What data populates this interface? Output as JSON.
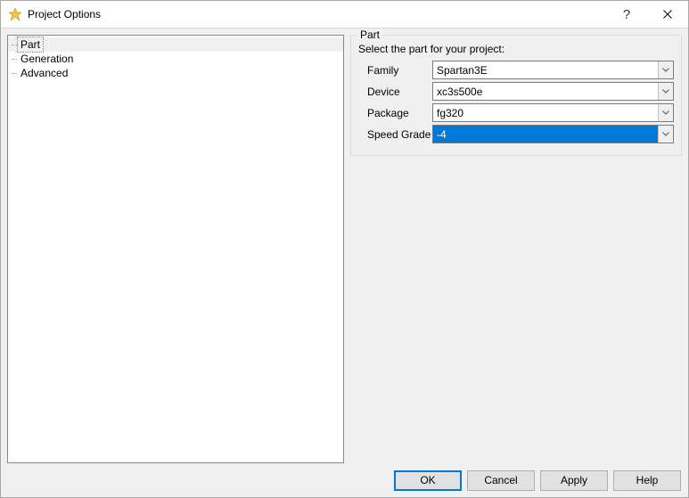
{
  "window": {
    "title": "Project Options"
  },
  "nav": {
    "items": [
      "Part",
      "Generation",
      "Advanced"
    ],
    "selected_index": 0
  },
  "panel": {
    "title": "Part",
    "prompt": "Select the part for your project:",
    "fields": {
      "family": {
        "label": "Family",
        "value": "Spartan3E"
      },
      "device": {
        "label": "Device",
        "value": "xc3s500e"
      },
      "package": {
        "label": "Package",
        "value": "fg320"
      },
      "speed_grade": {
        "label": "Speed Grade",
        "value": "-4",
        "focused": true
      }
    }
  },
  "buttons": {
    "ok": "OK",
    "cancel": "Cancel",
    "apply": "Apply",
    "help": "Help"
  }
}
